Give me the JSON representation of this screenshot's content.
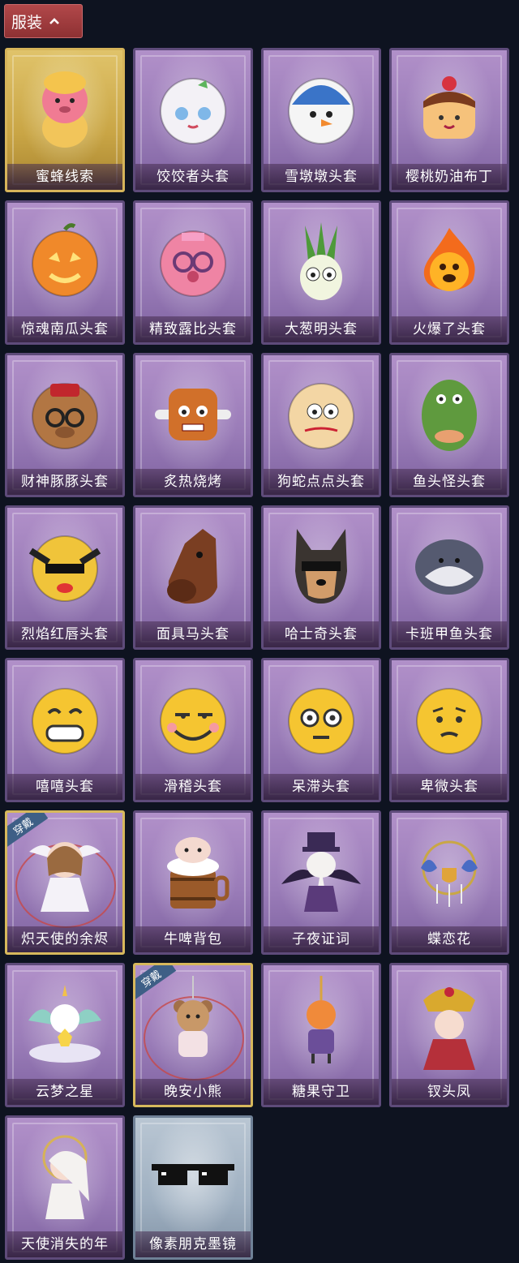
{
  "header": {
    "label": "服装",
    "icon": "chevron-up-icon"
  },
  "equipped_tag": "穿戴",
  "items": [
    {
      "name": "蜜蜂线索",
      "style": "gold",
      "icon": "bee-costume-icon"
    },
    {
      "name": "饺饺者头套",
      "style": "purple",
      "icon": "dumpling-head-icon"
    },
    {
      "name": "雪墩墩头套",
      "style": "purple",
      "icon": "snowman-head-icon"
    },
    {
      "name": "樱桃奶油布丁",
      "style": "purple",
      "icon": "pudding-head-icon"
    },
    {
      "name": "惊魂南瓜头套",
      "style": "purple",
      "icon": "pumpkin-head-icon"
    },
    {
      "name": "精致露比头套",
      "style": "purple",
      "icon": "pink-beaver-head-icon"
    },
    {
      "name": "大葱明头套",
      "style": "purple",
      "icon": "scallion-head-icon"
    },
    {
      "name": "火爆了头套",
      "style": "purple",
      "icon": "fire-head-icon"
    },
    {
      "name": "财神豚豚头套",
      "style": "purple",
      "icon": "capybara-head-icon"
    },
    {
      "name": "炙热烧烤",
      "style": "purple",
      "icon": "grilled-meat-icon"
    },
    {
      "name": "狗蛇点点头套",
      "style": "purple",
      "icon": "snake-head-icon"
    },
    {
      "name": "鱼头怪头套",
      "style": "purple",
      "icon": "fish-head-icon"
    },
    {
      "name": "烈焰红唇头套",
      "style": "purple",
      "icon": "yellow-mask-icon"
    },
    {
      "name": "面具马头套",
      "style": "purple",
      "icon": "horse-mask-icon"
    },
    {
      "name": "哈士奇头套",
      "style": "purple",
      "icon": "husky-head-icon"
    },
    {
      "name": "卡班甲鱼头套",
      "style": "purple",
      "icon": "grey-fish-head-icon"
    },
    {
      "name": "嘻嘻头套",
      "style": "purple",
      "icon": "grin-emoji-icon"
    },
    {
      "name": "滑稽头套",
      "style": "purple",
      "icon": "funny-emoji-icon"
    },
    {
      "name": "呆滞头套",
      "style": "purple",
      "icon": "stare-emoji-icon"
    },
    {
      "name": "卑微头套",
      "style": "purple",
      "icon": "humble-emoji-icon"
    },
    {
      "name": "炽天使的余烬",
      "style": "purple",
      "equipped": true,
      "icon": "angel-doll-icon"
    },
    {
      "name": "牛啤背包",
      "style": "purple",
      "icon": "beer-barrel-icon"
    },
    {
      "name": "子夜证词",
      "style": "purple",
      "icon": "plague-bird-icon"
    },
    {
      "name": "蝶恋花",
      "style": "purple",
      "icon": "butterfly-chime-icon"
    },
    {
      "name": "云梦之星",
      "style": "purple",
      "icon": "unicorn-cloud-icon"
    },
    {
      "name": "晚安小熊",
      "style": "purple",
      "equipped": true,
      "icon": "bear-charm-icon"
    },
    {
      "name": "糖果守卫",
      "style": "purple",
      "icon": "candy-guard-icon"
    },
    {
      "name": "钗头凤",
      "style": "purple",
      "icon": "phoenix-crown-icon"
    },
    {
      "name": "天使消失的年",
      "style": "purple",
      "icon": "angel-girl-icon"
    },
    {
      "name": "像素朋克墨镜",
      "style": "silver",
      "icon": "pixel-sunglasses-icon"
    }
  ]
}
